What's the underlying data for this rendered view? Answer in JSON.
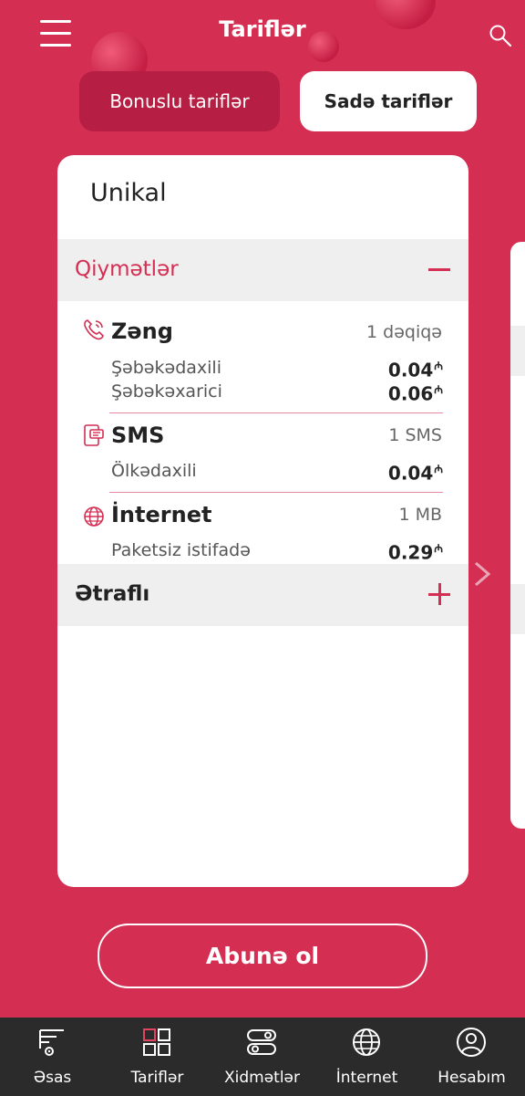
{
  "header": {
    "title": "Tariflər"
  },
  "segments": {
    "bonus_label": "Bonuslu tariflər",
    "sade_label": "Sadə tariflər",
    "selected": "Sadə tariflər"
  },
  "card": {
    "name": "Unikal",
    "prices_header": "Qiymətlər",
    "groups": [
      {
        "name": "Zəng",
        "unit": "1 dəqiqə",
        "icon": "phone-icon",
        "rows": [
          {
            "label": "Şəbəkədaxili",
            "value": "0.04"
          },
          {
            "label": "Şəbəkəxarici",
            "value": "0.06"
          }
        ]
      },
      {
        "name": "SMS",
        "unit": "1 SMS",
        "icon": "sms-icon",
        "rows": [
          {
            "label": "Ölkədaxili",
            "value": "0.04"
          }
        ]
      },
      {
        "name": "İnternet",
        "unit": "1 MB",
        "icon": "globe-icon",
        "rows": [
          {
            "label": "Paketsiz istifadə",
            "value": "0.29"
          }
        ]
      }
    ],
    "currency_symbol": "₼",
    "details_header": "Ətraflı"
  },
  "subscribe_label": "Abunə ol",
  "bottom_nav": {
    "items": [
      {
        "label": "Əsas",
        "icon": "home-settings-icon"
      },
      {
        "label": "Tariflər",
        "icon": "tariffs-grid-icon",
        "active": true
      },
      {
        "label": "Xidmətlər",
        "icon": "toggles-icon"
      },
      {
        "label": "İnternet",
        "icon": "globe-icon"
      },
      {
        "label": "Hesabım",
        "icon": "user-icon"
      }
    ]
  },
  "colors": {
    "accent": "#d42e52",
    "nav_bg": "#2b2b2b",
    "active_icon": "#e0445f"
  }
}
